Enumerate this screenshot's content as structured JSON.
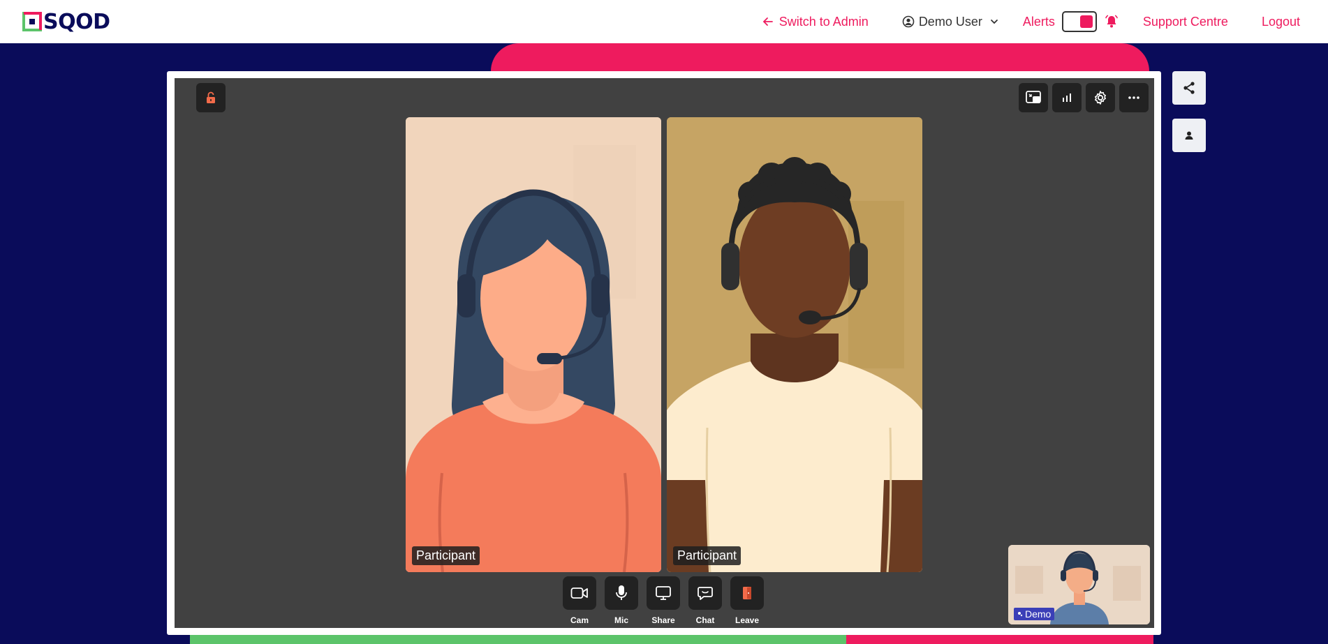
{
  "brand": {
    "name": "SQOD",
    "colors": {
      "navy": "#0a0c5a",
      "pink": "#ee1b5e",
      "green": "#5cc46a"
    }
  },
  "nav": {
    "switch_admin": "Switch to Admin",
    "user": "Demo User",
    "alerts": "Alerts",
    "alerts_enabled": true,
    "support": "Support Centre",
    "logout": "Logout"
  },
  "stage": {
    "tiles": [
      {
        "label": "Participant"
      },
      {
        "label": "Participant"
      }
    ],
    "self_view_label": "Demo",
    "controls": [
      {
        "label": "Cam",
        "icon": "camera-icon"
      },
      {
        "label": "Mic",
        "icon": "microphone-icon"
      },
      {
        "label": "Share",
        "icon": "screen-share-icon"
      },
      {
        "label": "Chat",
        "icon": "chat-icon"
      },
      {
        "label": "Leave",
        "icon": "leave-door-icon"
      }
    ],
    "top_right_tools": [
      "layout-icon",
      "stats-icon",
      "settings-gear-icon",
      "more-icon"
    ],
    "top_left_tool": "unlock-icon"
  },
  "side_tools": [
    "share-icon",
    "person-icon"
  ]
}
